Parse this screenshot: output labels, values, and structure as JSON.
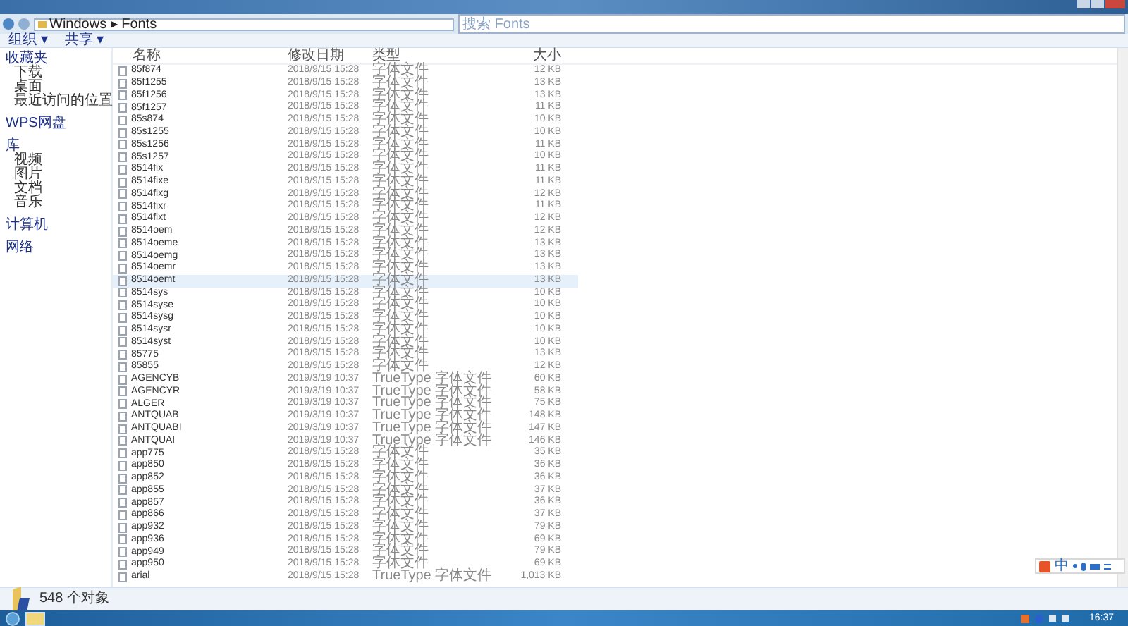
{
  "address_bar": {
    "path": [
      "Windows",
      "Fonts"
    ],
    "separator": "▸"
  },
  "search": {
    "placeholder": "搜索 Fonts"
  },
  "toolbar": [
    "组织 ▾",
    "共享 ▾"
  ],
  "sidebar": [
    {
      "label": "收藏夹",
      "children": [
        {
          "label": "下载"
        },
        {
          "label": "桌面"
        },
        {
          "label": "最近访问的位置"
        }
      ]
    },
    {
      "label": "WPS网盘"
    },
    {
      "label": "库",
      "children": [
        {
          "label": "视频"
        },
        {
          "label": "图片"
        },
        {
          "label": "文档"
        },
        {
          "label": "音乐"
        }
      ]
    },
    {
      "label": "计算机"
    },
    {
      "label": "网络"
    }
  ],
  "columns": [
    "名称",
    "修改日期",
    "类型",
    "大小"
  ],
  "rows": [
    {
      "name": "85f874",
      "modified": "2018/9/15 15:28",
      "type": "字体文件",
      "size": "12 KB",
      "selected": false
    },
    {
      "name": "85f1255",
      "modified": "2018/9/15 15:28",
      "type": "字体文件",
      "size": "13 KB",
      "selected": false
    },
    {
      "name": "85f1256",
      "modified": "2018/9/15 15:28",
      "type": "字体文件",
      "size": "13 KB",
      "selected": false
    },
    {
      "name": "85f1257",
      "modified": "2018/9/15 15:28",
      "type": "字体文件",
      "size": "11 KB",
      "selected": false
    },
    {
      "name": "85s874",
      "modified": "2018/9/15 15:28",
      "type": "字体文件",
      "size": "10 KB",
      "selected": false
    },
    {
      "name": "85s1255",
      "modified": "2018/9/15 15:28",
      "type": "字体文件",
      "size": "10 KB",
      "selected": false
    },
    {
      "name": "85s1256",
      "modified": "2018/9/15 15:28",
      "type": "字体文件",
      "size": "11 KB",
      "selected": false
    },
    {
      "name": "85s1257",
      "modified": "2018/9/15 15:28",
      "type": "字体文件",
      "size": "10 KB",
      "selected": false
    },
    {
      "name": "8514fix",
      "modified": "2018/9/15 15:28",
      "type": "字体文件",
      "size": "11 KB",
      "selected": false
    },
    {
      "name": "8514fixe",
      "modified": "2018/9/15 15:28",
      "type": "字体文件",
      "size": "11 KB",
      "selected": false
    },
    {
      "name": "8514fixg",
      "modified": "2018/9/15 15:28",
      "type": "字体文件",
      "size": "12 KB",
      "selected": false
    },
    {
      "name": "8514fixr",
      "modified": "2018/9/15 15:28",
      "type": "字体文件",
      "size": "11 KB",
      "selected": false
    },
    {
      "name": "8514fixt",
      "modified": "2018/9/15 15:28",
      "type": "字体文件",
      "size": "12 KB",
      "selected": false
    },
    {
      "name": "8514oem",
      "modified": "2018/9/15 15:28",
      "type": "字体文件",
      "size": "12 KB",
      "selected": false
    },
    {
      "name": "8514oeme",
      "modified": "2018/9/15 15:28",
      "type": "字体文件",
      "size": "13 KB",
      "selected": false
    },
    {
      "name": "8514oemg",
      "modified": "2018/9/15 15:28",
      "type": "字体文件",
      "size": "13 KB",
      "selected": false
    },
    {
      "name": "8514oemr",
      "modified": "2018/9/15 15:28",
      "type": "字体文件",
      "size": "13 KB",
      "selected": false
    },
    {
      "name": "8514oemt",
      "modified": "2018/9/15 15:28",
      "type": "字体文件",
      "size": "13 KB",
      "selected": true
    },
    {
      "name": "8514sys",
      "modified": "2018/9/15 15:28",
      "type": "字体文件",
      "size": "10 KB",
      "selected": false
    },
    {
      "name": "8514syse",
      "modified": "2018/9/15 15:28",
      "type": "字体文件",
      "size": "10 KB",
      "selected": false
    },
    {
      "name": "8514sysg",
      "modified": "2018/9/15 15:28",
      "type": "字体文件",
      "size": "10 KB",
      "selected": false
    },
    {
      "name": "8514sysr",
      "modified": "2018/9/15 15:28",
      "type": "字体文件",
      "size": "10 KB",
      "selected": false
    },
    {
      "name": "8514syst",
      "modified": "2018/9/15 15:28",
      "type": "字体文件",
      "size": "10 KB",
      "selected": false
    },
    {
      "name": "85775",
      "modified": "2018/9/15 15:28",
      "type": "字体文件",
      "size": "13 KB",
      "selected": false
    },
    {
      "name": "85855",
      "modified": "2018/9/15 15:28",
      "type": "字体文件",
      "size": "12 KB",
      "selected": false
    },
    {
      "name": "AGENCYB",
      "modified": "2019/3/19 10:37",
      "type": "TrueType 字体文件",
      "size": "60 KB",
      "selected": false
    },
    {
      "name": "AGENCYR",
      "modified": "2019/3/19 10:37",
      "type": "TrueType 字体文件",
      "size": "58 KB",
      "selected": false
    },
    {
      "name": "ALGER",
      "modified": "2019/3/19 10:37",
      "type": "TrueType 字体文件",
      "size": "75 KB",
      "selected": false
    },
    {
      "name": "ANTQUAB",
      "modified": "2019/3/19 10:37",
      "type": "TrueType 字体文件",
      "size": "148 KB",
      "selected": false
    },
    {
      "name": "ANTQUABI",
      "modified": "2019/3/19 10:37",
      "type": "TrueType 字体文件",
      "size": "147 KB",
      "selected": false
    },
    {
      "name": "ANTQUAI",
      "modified": "2019/3/19 10:37",
      "type": "TrueType 字体文件",
      "size": "146 KB",
      "selected": false
    },
    {
      "name": "app775",
      "modified": "2018/9/15 15:28",
      "type": "字体文件",
      "size": "35 KB",
      "selected": false
    },
    {
      "name": "app850",
      "modified": "2018/9/15 15:28",
      "type": "字体文件",
      "size": "36 KB",
      "selected": false
    },
    {
      "name": "app852",
      "modified": "2018/9/15 15:28",
      "type": "字体文件",
      "size": "36 KB",
      "selected": false
    },
    {
      "name": "app855",
      "modified": "2018/9/15 15:28",
      "type": "字体文件",
      "size": "37 KB",
      "selected": false
    },
    {
      "name": "app857",
      "modified": "2018/9/15 15:28",
      "type": "字体文件",
      "size": "36 KB",
      "selected": false
    },
    {
      "name": "app866",
      "modified": "2018/9/15 15:28",
      "type": "字体文件",
      "size": "37 KB",
      "selected": false
    },
    {
      "name": "app932",
      "modified": "2018/9/15 15:28",
      "type": "字体文件",
      "size": "79 KB",
      "selected": false
    },
    {
      "name": "app936",
      "modified": "2018/9/15 15:28",
      "type": "字体文件",
      "size": "69 KB",
      "selected": false
    },
    {
      "name": "app949",
      "modified": "2018/9/15 15:28",
      "type": "字体文件",
      "size": "79 KB",
      "selected": false
    },
    {
      "name": "app950",
      "modified": "2018/9/15 15:28",
      "type": "字体文件",
      "size": "69 KB",
      "selected": false
    },
    {
      "name": "arial",
      "modified": "2018/9/15 15:28",
      "type": "TrueType 字体文件",
      "size": "1,013 KB",
      "selected": false
    }
  ],
  "status_bar": {
    "count": "548 个对象"
  },
  "ime_bar": {
    "mode": "中"
  },
  "taskbar": {
    "clock": "16:37"
  }
}
